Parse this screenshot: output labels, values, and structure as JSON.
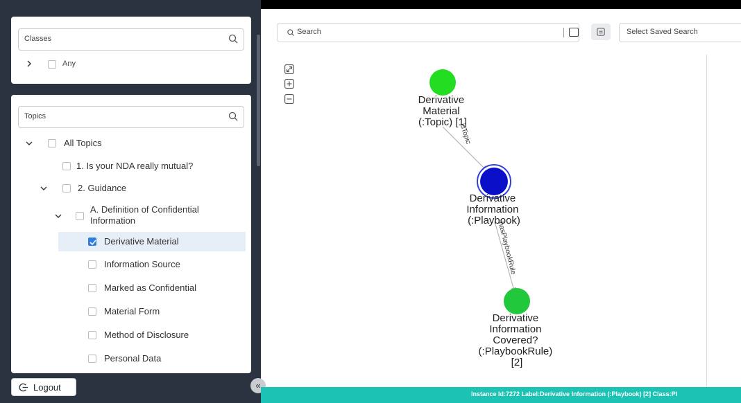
{
  "classes": {
    "placeholder": "Classes",
    "items": [
      {
        "label": "Any"
      }
    ]
  },
  "topics": {
    "placeholder": "Topics",
    "all": "All Topics",
    "q1": "1. Is your NDA really mutual?",
    "guidance": "2. Guidance",
    "defconf": "A. Definition of Confidential Information",
    "leaves": [
      {
        "label": "Derivative Material",
        "checked": true
      },
      {
        "label": "Information Source",
        "checked": false
      },
      {
        "label": "Marked as Confidential",
        "checked": false
      },
      {
        "label": "Material Form",
        "checked": false
      },
      {
        "label": "Method of Disclosure",
        "checked": false
      },
      {
        "label": "Personal Data",
        "checked": false
      }
    ]
  },
  "logout": "Logout",
  "collapse": "«",
  "main": {
    "search_placeholder": "Search",
    "saved_search_placeholder": "Select Saved Search"
  },
  "graph": {
    "nodes": [
      {
        "label": "Derivative Material (:Topic) [1]",
        "lines": [
          "Derivative",
          "Material",
          "(:Topic) [1]"
        ],
        "color": "#22dd22"
      },
      {
        "label": "Derivative Information (:Playbook)",
        "lines": [
          "Derivative",
          "Information",
          "(:Playbook)"
        ],
        "color": "#0a10c8"
      },
      {
        "label": "Derivative Information Covered? (:PlaybookRule) [2]",
        "lines": [
          "Derivative",
          "Information",
          "Covered?",
          "(:PlaybookRule)",
          "[2]"
        ],
        "color": "#22c83c"
      }
    ],
    "edges": [
      {
        "label": "isTopic"
      },
      {
        "label": "hasPlaybookRule"
      }
    ]
  },
  "status": "Instance Id:7272 Label:Derivative Information (:Playbook) [2] Class:Pl"
}
